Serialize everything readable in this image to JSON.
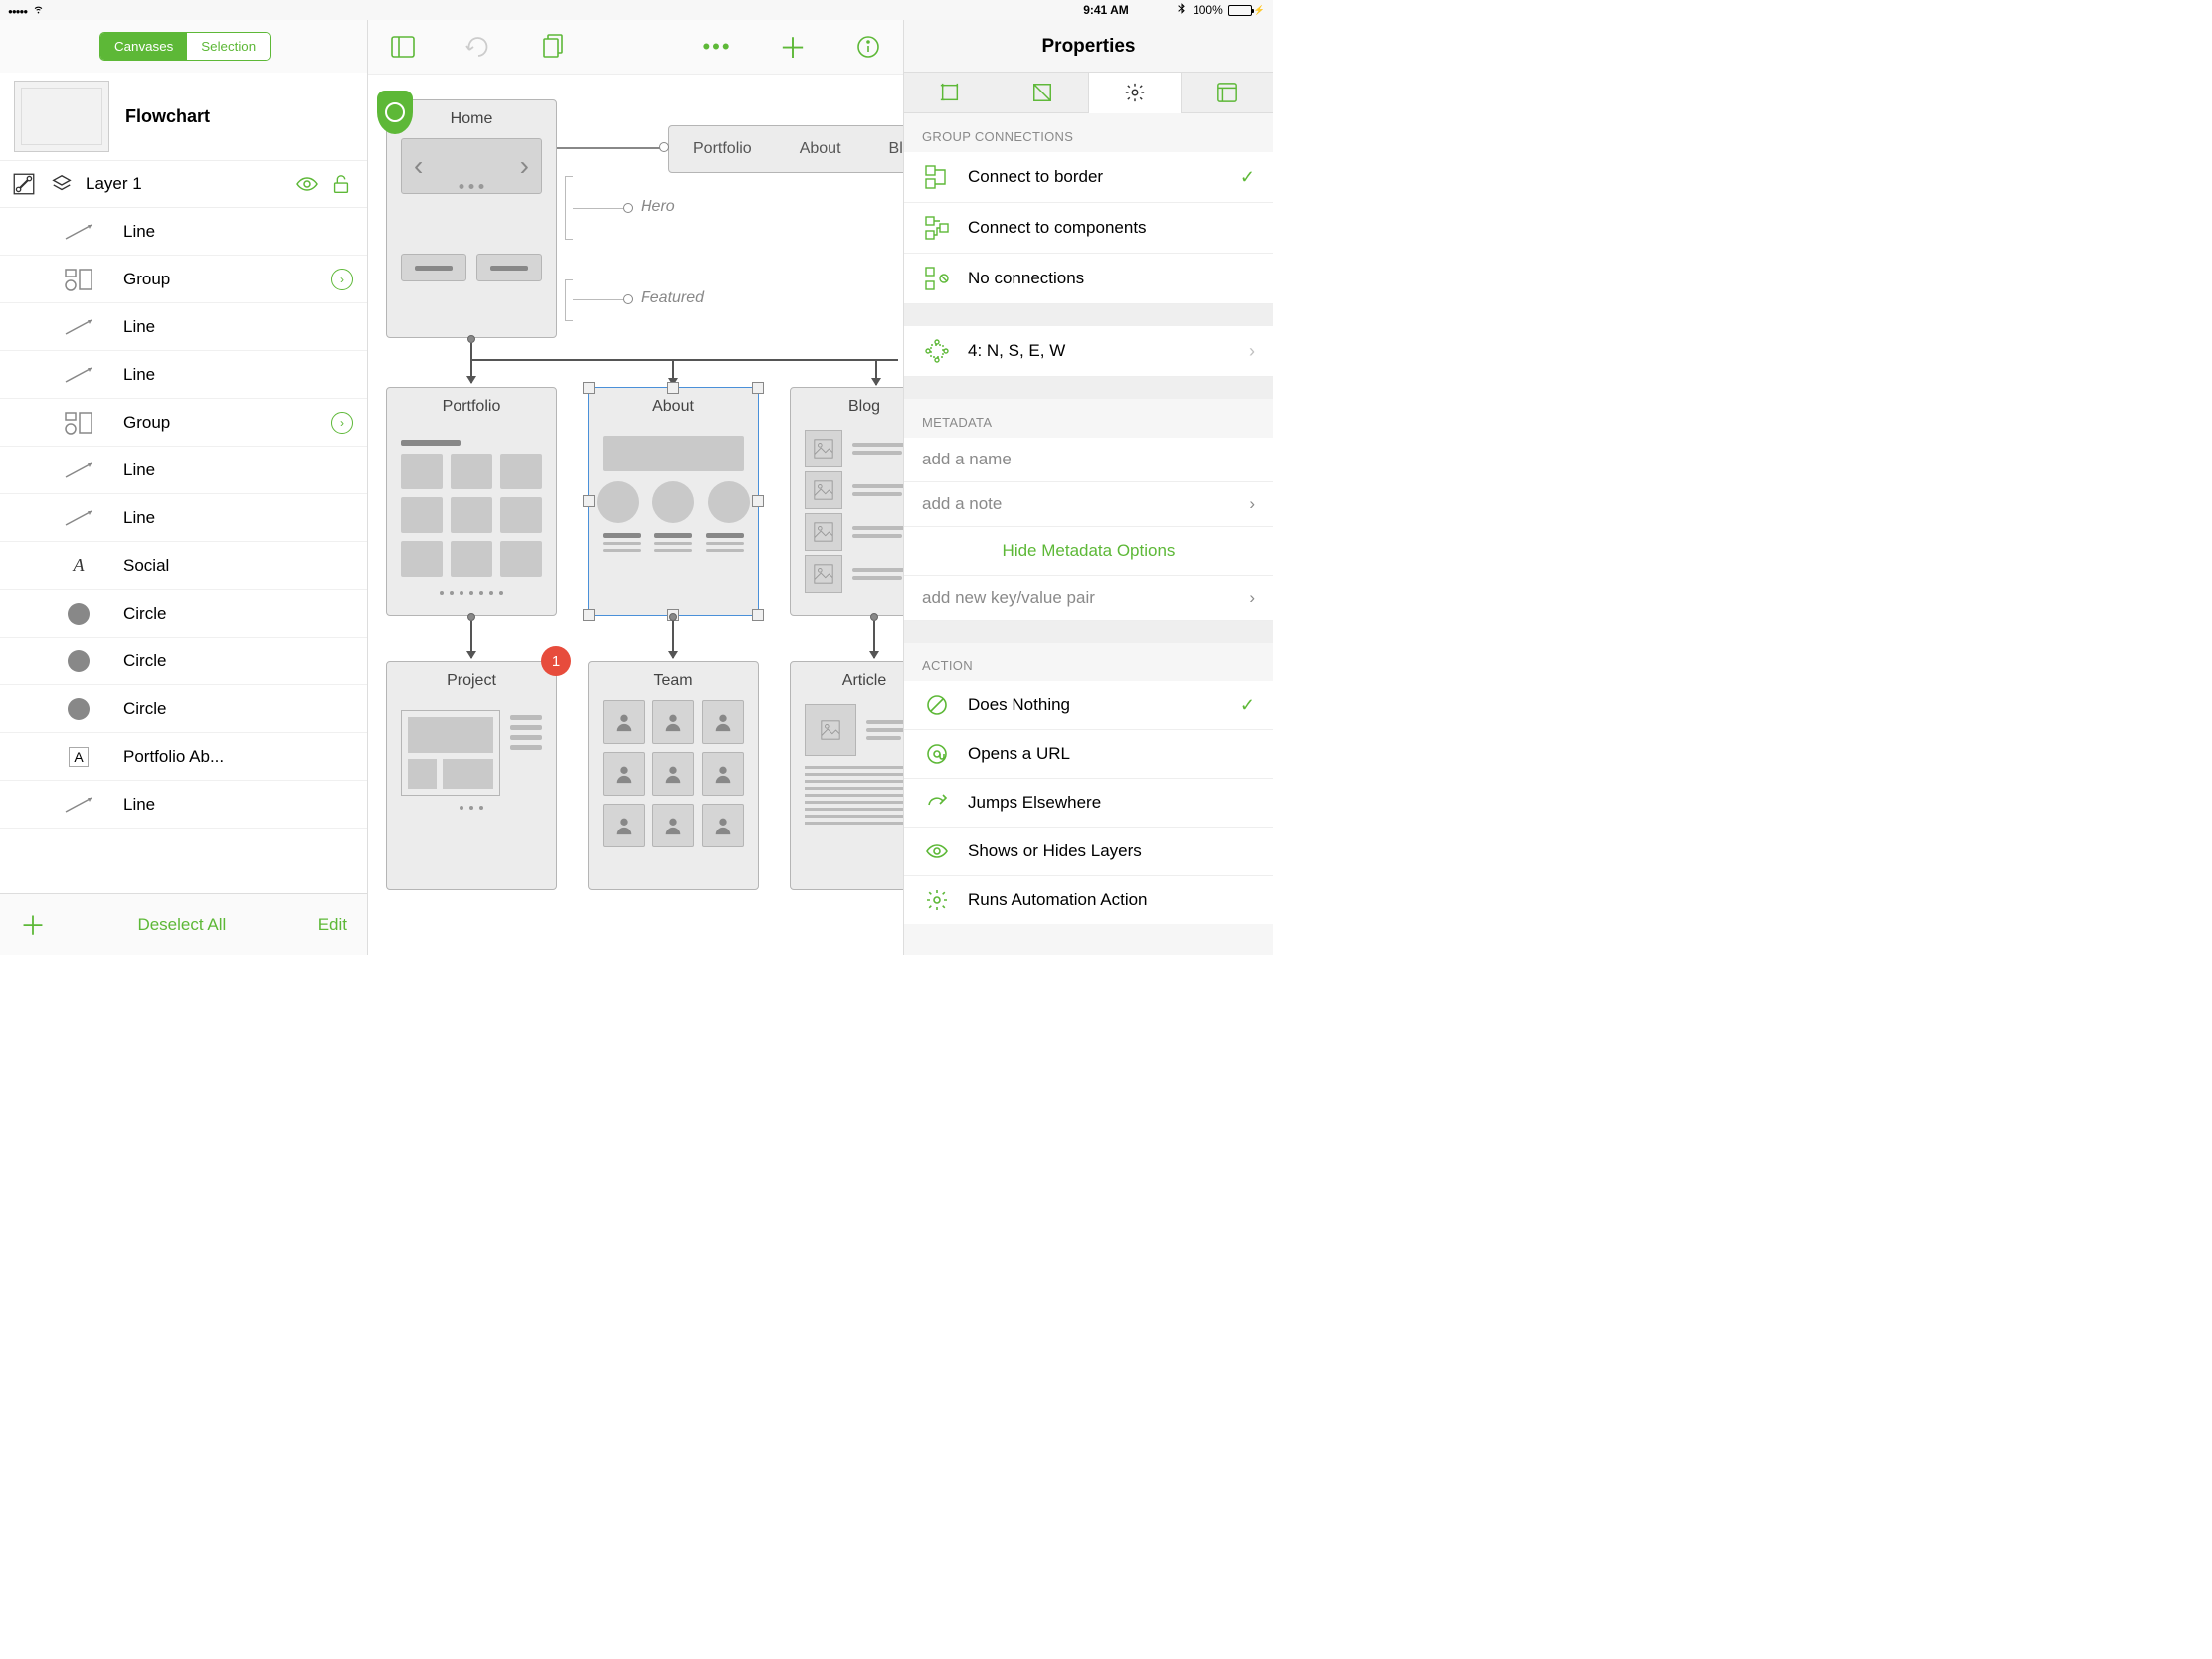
{
  "status": {
    "time": "9:41 AM",
    "battery_pct": "100%",
    "battery_fill": "100%"
  },
  "sidebar": {
    "seg": {
      "canvases": "Canvases",
      "selection": "Selection"
    },
    "canvas_title": "Flowchart",
    "layer": "Layer 1",
    "items": [
      {
        "type": "line",
        "label": "Line"
      },
      {
        "type": "group",
        "label": "Group",
        "expandable": true
      },
      {
        "type": "line",
        "label": "Line"
      },
      {
        "type": "line",
        "label": "Line"
      },
      {
        "type": "group",
        "label": "Group",
        "expandable": true
      },
      {
        "type": "line",
        "label": "Line"
      },
      {
        "type": "line",
        "label": "Line"
      },
      {
        "type": "text-social",
        "label": "Social"
      },
      {
        "type": "circle",
        "label": "Circle"
      },
      {
        "type": "circle",
        "label": "Circle"
      },
      {
        "type": "circle",
        "label": "Circle"
      },
      {
        "type": "text-portfolio",
        "label": "Portfolio    Ab..."
      },
      {
        "type": "line",
        "label": "Line"
      }
    ],
    "footer": {
      "deselect": "Deselect All",
      "edit": "Edit"
    }
  },
  "canvas": {
    "cards": {
      "home": "Home",
      "portfolio": "Portfolio",
      "about": "About",
      "blog": "Blog",
      "project": "Project",
      "team": "Team",
      "article": "Article"
    },
    "tabs": [
      "Portfolio",
      "About",
      "Blog"
    ],
    "notes": {
      "hero": "Hero",
      "featured": "Featured"
    },
    "badge": "1"
  },
  "props": {
    "title": "Properties",
    "section_group": "GROUP CONNECTIONS",
    "conn": {
      "border": "Connect to border",
      "components": "Connect to components",
      "none": "No connections",
      "magnets": "4: N, S, E, W"
    },
    "section_meta": "METADATA",
    "meta": {
      "name_ph": "add a name",
      "note_ph": "add a note",
      "hide": "Hide Metadata Options",
      "kv_ph": "add new key/value pair"
    },
    "section_action": "ACTION",
    "actions": {
      "nothing": "Does Nothing",
      "url": "Opens a URL",
      "jump": "Jumps Elsewhere",
      "layers": "Shows or Hides Layers",
      "automation": "Runs Automation Action"
    }
  }
}
